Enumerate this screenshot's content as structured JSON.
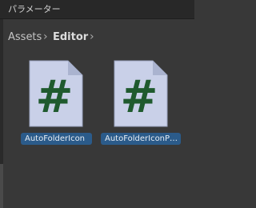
{
  "window": {
    "title": "パラメーター"
  },
  "breadcrumb": {
    "items": [
      {
        "label": "Assets"
      },
      {
        "label": "Editor"
      }
    ],
    "separator": "›"
  },
  "assets": [
    {
      "name": "AutoFolderIcon",
      "icon": "csharp-script-icon",
      "glyph": "#"
    },
    {
      "name": "AutoFolderIconP…",
      "icon": "csharp-script-icon",
      "glyph": "#"
    }
  ],
  "colors": {
    "background": "#383838",
    "selection": "#2b5b8a",
    "icon_page": "#c9d0e8",
    "icon_glyph": "#1f5a2e"
  }
}
